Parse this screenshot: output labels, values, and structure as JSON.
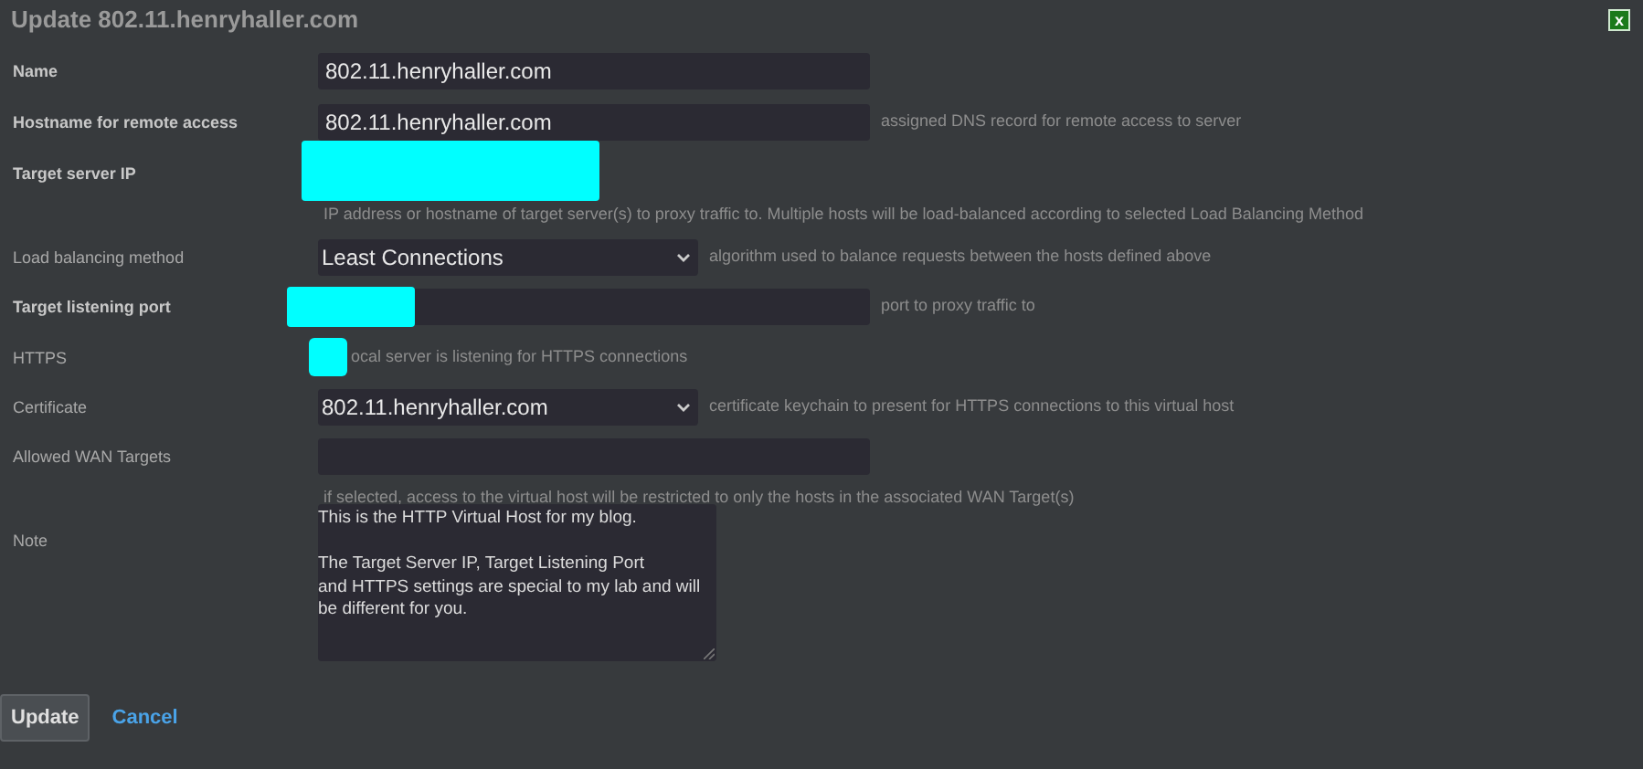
{
  "window": {
    "title": "Update 802.11.henryhaller.com",
    "close": "x"
  },
  "fields": [
    {
      "kind": "text",
      "label": "Name",
      "required": true,
      "value": "802.11.henryhaller.com",
      "redacted": false
    },
    {
      "kind": "text",
      "label": "Hostname for remote access",
      "required": true,
      "value": "802.11.henryhaller.com",
      "hint": "assigned DNS record for remote access to server",
      "redacted": false
    },
    {
      "kind": "blocked",
      "label": "Target server IP",
      "required": true,
      "note": "IP address or hostname of target server(s) to proxy traffic to. Multiple hosts will be load-balanced according to selected Load Balancing Method",
      "redacted": true
    },
    {
      "kind": "select",
      "label": "Load balancing method",
      "required": false,
      "value": "Least Connections",
      "hint": "algorithm used to balance requests between the hosts defined above",
      "redacted": false
    },
    {
      "kind": "text",
      "label": "Target listening port",
      "required": true,
      "hint": "port to proxy traffic to",
      "redacted": true
    },
    {
      "kind": "checkbox",
      "label": "HTTPS",
      "required": false,
      "hint": "ocal server is listening for HTTPS connections",
      "redacted": true
    },
    {
      "kind": "select",
      "label": "Certificate",
      "required": false,
      "value": "802.11.henryhaller.com",
      "hint": "certificate keychain to present for HTTPS connections to this virtual host",
      "redacted": false
    },
    {
      "kind": "text",
      "label": "Allowed WAN Targets",
      "required": false,
      "note": "if selected, access to the virtual host will be restricted to only the hosts in the associated WAN Target(s)",
      "redacted": false
    },
    {
      "kind": "textarea",
      "label": "Note",
      "required": false,
      "value": "This is the HTTP Virtual Host for my blog.\n\nThe Target Server IP, Target Listening Port\nand HTTPS settings are special to my lab and will\nbe different for you.",
      "redacted": false
    }
  ],
  "buttons": [
    {
      "kind": "primary",
      "label": "Update"
    },
    {
      "kind": "link",
      "label": "Cancel"
    }
  ]
}
